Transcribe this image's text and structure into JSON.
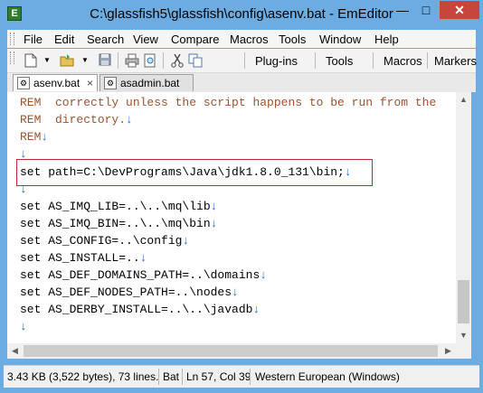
{
  "window": {
    "title": "C:\\glassfish5\\glassfish\\config\\asenv.bat - EmEditor",
    "app_icon": "emeditor-app-icon",
    "controls": {
      "minimize": "—",
      "maximize": "□",
      "close": "✕"
    }
  },
  "menu": {
    "items": [
      {
        "label": "File"
      },
      {
        "label": "Edit"
      },
      {
        "label": "Search"
      },
      {
        "label": "View"
      },
      {
        "label": "Compare"
      },
      {
        "label": "Macros"
      },
      {
        "label": "Tools"
      },
      {
        "label": "Window"
      },
      {
        "label": "Help"
      }
    ]
  },
  "toolbar": {
    "icons": [
      "new-file-icon",
      "dropdown-arrow-icon",
      "open-folder-icon",
      "dropdown-arrow-icon",
      "save-icon",
      "print-icon",
      "print-preview-icon",
      "cut-icon",
      "copy-icon"
    ],
    "labels": {
      "plugins": "Plug-ins",
      "tools": "Tools",
      "macros": "Macros",
      "markers": "Markers"
    }
  },
  "tabs": [
    {
      "label": "asenv.bat",
      "active": true,
      "close": "×"
    },
    {
      "label": "asadmin.bat",
      "active": false
    }
  ],
  "editor": {
    "newline_glyph": "↓",
    "lines": [
      {
        "text": "REM  correctly unless the script happens to be run from the ",
        "type": "rem"
      },
      {
        "text": "REM  directory.",
        "type": "rem"
      },
      {
        "text": "REM",
        "type": "rem"
      },
      {
        "text": "",
        "type": "code"
      },
      {
        "text": "set path=C:\\DevPrograms\\Java\\jdk1.8.0_131\\bin;",
        "type": "code"
      },
      {
        "text": "",
        "type": "code"
      },
      {
        "text": "set AS_IMQ_LIB=..\\..\\mq\\lib",
        "type": "code"
      },
      {
        "text": "set AS_IMQ_BIN=..\\..\\mq\\bin",
        "type": "code"
      },
      {
        "text": "set AS_CONFIG=..\\config",
        "type": "code"
      },
      {
        "text": "set AS_INSTALL=..",
        "type": "code"
      },
      {
        "text": "set AS_DEF_DOMAINS_PATH=..\\domains",
        "type": "code"
      },
      {
        "text": "set AS_DEF_NODES_PATH=..\\nodes",
        "type": "code"
      },
      {
        "text": "set AS_DERBY_INSTALL=..\\..\\javadb",
        "type": "code"
      },
      {
        "text": "",
        "type": "code"
      }
    ],
    "colors": {
      "rem": "#a0522d",
      "newline": "#1f6fd0",
      "highlight_border": "#c0262d"
    }
  },
  "statusbar": {
    "file_info": "3.43 KB (3,522 bytes), 73 lines.",
    "file_type": "Bat",
    "position": "Ln 57, Col 39",
    "encoding": "Western European (Windows)"
  }
}
